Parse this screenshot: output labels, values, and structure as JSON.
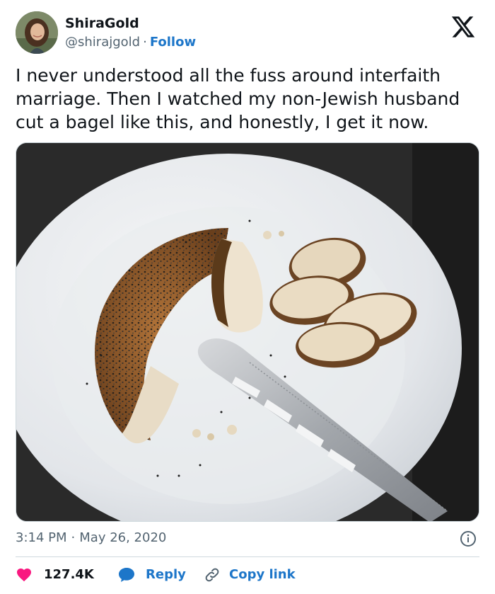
{
  "author": {
    "name": "ShiraGold",
    "handle": "@shirajgold",
    "separator": "·",
    "follow_label": "Follow"
  },
  "tweet": {
    "text": "I never understood all the fuss around interfaith\nmarriage. Then I watched my non-Jewish husband\ncut a bagel like this, and honestly, I get it now.",
    "photo_description_icon": "photo-of-bagel-sliced-into-rounds-on-plate-with-knife"
  },
  "meta": {
    "time": "3:14 PM",
    "separator": "·",
    "date": "May 26, 2020"
  },
  "actions": {
    "likes": "127.4K",
    "reply_label": "Reply",
    "copy_label": "Copy link"
  },
  "colors": {
    "accent": "#1d76c9",
    "like": "#f91880",
    "secondary_text": "#536471",
    "text": "#0f1419",
    "divider": "#cfd9de"
  },
  "icons": {
    "brand": "x-logo-icon",
    "info": "info-icon",
    "like": "heart-icon",
    "reply": "speech-bubble-icon",
    "copy": "link-icon"
  }
}
